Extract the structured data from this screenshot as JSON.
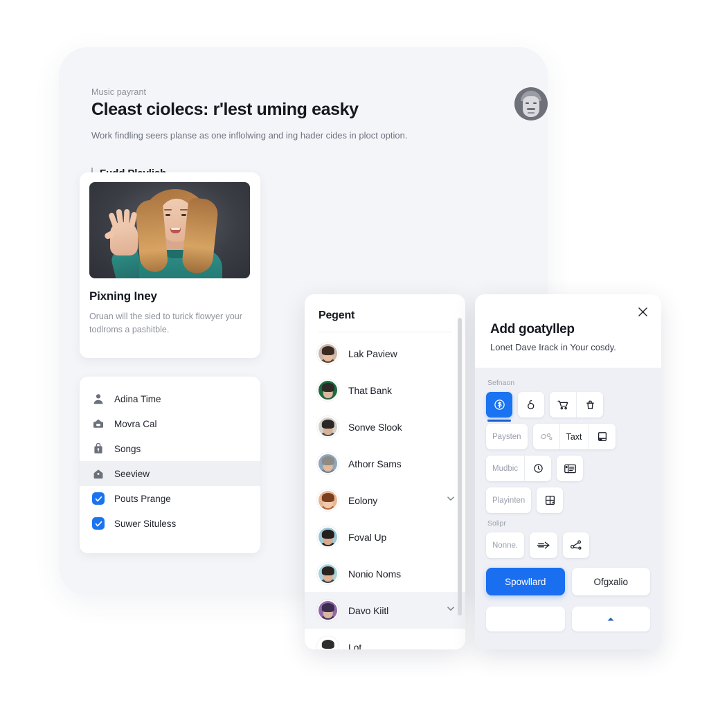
{
  "app": {
    "eyebrow": "Music payrant",
    "title": "Cleast ciolecs: r'lest uming easky",
    "subtitle": "Work findling seers planse as one inflolwing and ing hader cides in ploct option.",
    "avatar_name": "user-avatar",
    "section": {
      "title": "Fudd Playlish"
    }
  },
  "media_card": {
    "image_alt": "woman-waving-photo",
    "title": "Pixning Iney",
    "description": "Oruan will the sied to turick flowyer your todlroms a pashitble."
  },
  "menu": {
    "items": [
      {
        "label": "Adina Time",
        "icon": "person-icon",
        "active": false,
        "badge": false
      },
      {
        "label": "Movra Cal",
        "icon": "bank-icon",
        "active": false,
        "badge": false
      },
      {
        "label": "Songs",
        "icon": "lock-bag-icon",
        "active": false,
        "badge": false
      },
      {
        "label": "Seeview",
        "icon": "home-icon",
        "active": true,
        "badge": false
      },
      {
        "label": "Pouts Prange",
        "icon": "check-badge-icon",
        "active": false,
        "badge": true
      },
      {
        "label": "Suwer Situless",
        "icon": "check-badge-icon",
        "active": false,
        "badge": true
      }
    ]
  },
  "contacts": {
    "title": "Pegent",
    "items": [
      {
        "name": "Lak Paview",
        "chevron": false,
        "active": false,
        "hair": "#3a2a22",
        "skin": "#e8bda0",
        "bg": "#cbb8ad",
        "body": "#5a4236"
      },
      {
        "name": "That Bank",
        "chevron": false,
        "active": false,
        "hair": "#2d2a28",
        "skin": "#dcb79c",
        "bg": "#1d6b3f",
        "body": "#2f5f44"
      },
      {
        "name": "Sonve Slook",
        "chevron": false,
        "active": false,
        "hair": "#2b2724",
        "skin": "#d9b296",
        "bg": "#d4d0cb",
        "body": "#4a4f58"
      },
      {
        "name": "Athorr Sams",
        "chevron": false,
        "active": false,
        "hair": "#8e8a85",
        "skin": "#e0bb9e",
        "bg": "#8fa7bd",
        "body": "#6f7f90"
      },
      {
        "name": "Eolony",
        "chevron": true,
        "active": false,
        "hair": "#7a3f1e",
        "skin": "#f0c9ab",
        "bg": "#e8b894",
        "body": "#b86b44"
      },
      {
        "name": "Foval Up",
        "chevron": false,
        "active": false,
        "hair": "#231f1d",
        "skin": "#d8ab8c",
        "bg": "#9ec7d6",
        "body": "#23282e"
      },
      {
        "name": "Nonio Noms",
        "chevron": false,
        "active": false,
        "hair": "#2a2320",
        "skin": "#e0b193",
        "bg": "#a9d2dd",
        "body": "#3b4650"
      },
      {
        "name": "Davo Kiitl",
        "chevron": true,
        "active": true,
        "hair": "#3c2d4e",
        "skin": "#d9b6a0",
        "bg": "#8f6aa8",
        "body": "#4b3560"
      },
      {
        "name": "Lot",
        "chevron": false,
        "active": false,
        "hair": "#2e2e2e",
        "skin": "#ffffff",
        "bg": "#ffffff",
        "body": "#ffffff"
      }
    ]
  },
  "dialog": {
    "close_icon": "close-icon",
    "title": "Add goatyllep",
    "subtitle": "Lonet Dave Irack in Your cosdy.",
    "sections": [
      {
        "label": "Sefnaon",
        "rows": [
          {
            "groups": [
              {
                "buttons": [
                  {
                    "text": "",
                    "icon": "dollar-circle-icon",
                    "style": "primary"
                  }
                ]
              },
              {
                "buttons": [
                  {
                    "text": "",
                    "icon": "hook-icon",
                    "style": "plain"
                  }
                ]
              },
              {
                "buttons": [
                  {
                    "text": "",
                    "icon": "cart-icon",
                    "style": "plain"
                  },
                  {
                    "text": "",
                    "icon": "trash-icon",
                    "style": "plain"
                  }
                ]
              }
            ]
          },
          {
            "groups": [
              {
                "buttons": [
                  {
                    "text": "Paysten",
                    "icon": "",
                    "style": "plain"
                  }
                ]
              },
              {
                "buttons": [
                  {
                    "text": "",
                    "icon": "blob-icon",
                    "style": "faded"
                  },
                  {
                    "text": "Taxt",
                    "icon": "",
                    "style": "dark"
                  },
                  {
                    "text": "",
                    "icon": "tablet-icon",
                    "style": "plain"
                  }
                ]
              }
            ]
          },
          {
            "groups": [
              {
                "buttons": [
                  {
                    "text": "Mudbic",
                    "icon": "",
                    "style": "plain"
                  },
                  {
                    "text": "",
                    "icon": "clock-icon",
                    "style": "plain"
                  }
                ]
              },
              {
                "buttons": [
                  {
                    "text": "",
                    "icon": "list-panel-icon",
                    "style": "plain"
                  }
                ]
              }
            ]
          },
          {
            "groups": [
              {
                "buttons": [
                  {
                    "text": "Playinten",
                    "icon": "",
                    "style": "plain"
                  }
                ]
              },
              {
                "buttons": [
                  {
                    "text": "",
                    "icon": "window-icon",
                    "style": "plain"
                  }
                ]
              }
            ]
          }
        ]
      },
      {
        "label": "Solipr",
        "rows": [
          {
            "groups": [
              {
                "buttons": [
                  {
                    "text": "Nonne.",
                    "icon": "",
                    "style": "plain"
                  }
                ]
              },
              {
                "buttons": [
                  {
                    "text": "",
                    "icon": "arrow-right-icon",
                    "style": "plain"
                  }
                ]
              },
              {
                "buttons": [
                  {
                    "text": "",
                    "icon": "share-nodes-icon",
                    "style": "plain"
                  }
                ]
              }
            ]
          }
        ]
      }
    ],
    "primary_button": "Spowllard",
    "secondary_button": "Ofgxalio"
  },
  "colors": {
    "accent": "#1a73f0",
    "primary_button": "#1a6ef0",
    "page_bg": "#ffffff",
    "app_card_bg": "#f4f5f8",
    "dialog_bg": "#eef0f5",
    "active_row": "#f2f3f7"
  }
}
